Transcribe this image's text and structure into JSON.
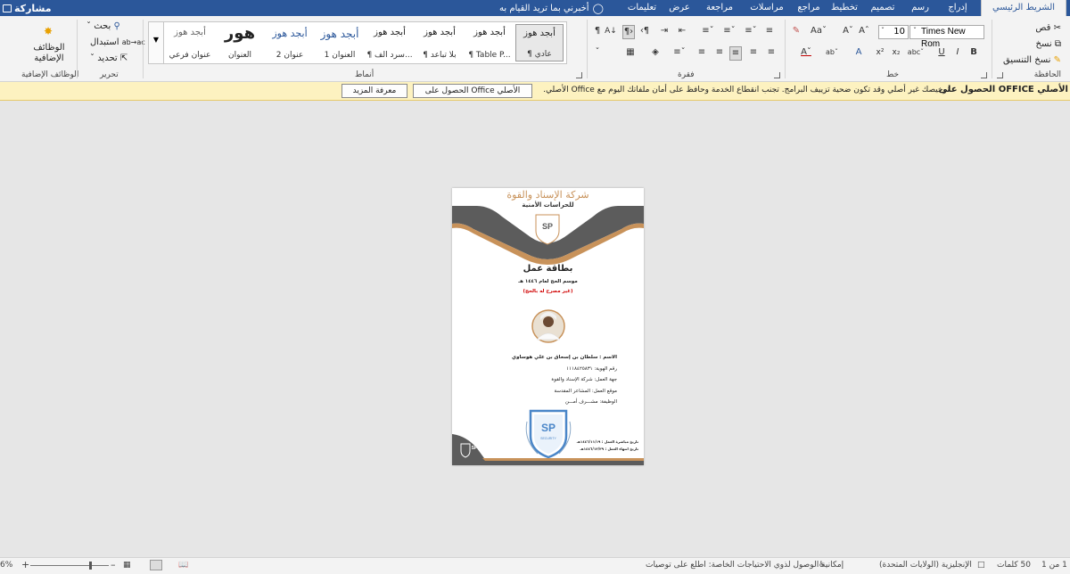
{
  "tabs": [
    "الشريط الرئيسي",
    "إدراج",
    "رسم",
    "تصميم",
    "تخطيط",
    "مراجع",
    "مراسلات",
    "مراجعة",
    "عرض",
    "تعليمات"
  ],
  "tell_me": "أخبرني بما تريد القيام به",
  "share": "مشاركة",
  "clipboard": {
    "cut": "قص",
    "copy": "نسخ",
    "format_painter": "نسخ التنسيق",
    "label": "الحافظة"
  },
  "font": {
    "name": "Times New Rom",
    "size": "10",
    "label": "خط"
  },
  "paragraph": {
    "label": "فقرة"
  },
  "styles": {
    "label": "أنماط",
    "items": [
      {
        "sample": "أبجد هوز",
        "name": "¶ عادي"
      },
      {
        "sample": "أبجد هوز",
        "name": "¶ Table P..."
      },
      {
        "sample": "أبجد هوز",
        "name": "¶ بلا تباعد"
      },
      {
        "sample": "أبجد هوز",
        "name": "¶ سرد الف..."
      },
      {
        "sample": "أبجد هوز",
        "name": "العنوان 1"
      },
      {
        "sample": "أبجد هوز",
        "name": "عنوان 2"
      },
      {
        "sample": "هور",
        "name": "العنوان"
      },
      {
        "sample": "أبجد هوز",
        "name": "عنوان فرعي"
      }
    ]
  },
  "editing": {
    "find": "بحث",
    "replace": "استبدال",
    "select": "تحديد",
    "label": "تحرير"
  },
  "addins": {
    "button": "الوظائف الإضافية",
    "label": "الوظائف الإضافية"
  },
  "message_bar": {
    "title": "الحصول على OFFICE الأصلي",
    "text": "ترخيصك غير أصلي وقد تكون ضحية تزييف البرامج. تجنب انقطاع الخدمة وحافظ على أمان ملفاتك اليوم مع Office الأصلي.",
    "get_button": "الحصول على Office الأصلي",
    "learn_button": "معرفة المزيد"
  },
  "card": {
    "company": "شركة الإسناد والقوة",
    "subtitle": "للحراسات الأمنية",
    "logo": "SP",
    "title": "بطاقة عمل",
    "season": "موسم الحج لعام ١٤٤٦ هـ",
    "note": "(غير مصرح له بالحج)",
    "fields": [
      {
        "label": "الاسم :",
        "value": "سلطان بن إسحاق بن علي هوساوي"
      },
      {
        "label": "رقم الهوية:",
        "value": "١١١٨٤٢٥٨٣١"
      },
      {
        "label": "جهة العمل:",
        "value": "شركة الإسناد والقوة"
      },
      {
        "label": "موقع العمل:",
        "value": "المشاعر المقدسة"
      },
      {
        "label": "الوظيفة:",
        "value": "مشـــرف أمـــن"
      }
    ],
    "start_date": "تاريخ مباشرة العمل : ١٤٤٦/١١/١٩هـ",
    "end_date": "تاريخ انتهاء العمل : ١٤٤٦/١٢/٢٩هـ",
    "security_text": "SECURITY"
  },
  "status": {
    "page": "صفحة 1 من 1",
    "words": "50 كلمات",
    "language": "الإنجليزية (الولايات المتحدة)",
    "accessibility": "إمكانية الوصول لذوي الاحتياجات الخاصة: اطلع على توصيات",
    "zoom": "6%"
  },
  "colors": {
    "ribbon_blue": "#2b579a",
    "accent_tan": "#c8925a",
    "accent_gray": "#5c5c5c",
    "shield_blue": "#4a86c8"
  }
}
